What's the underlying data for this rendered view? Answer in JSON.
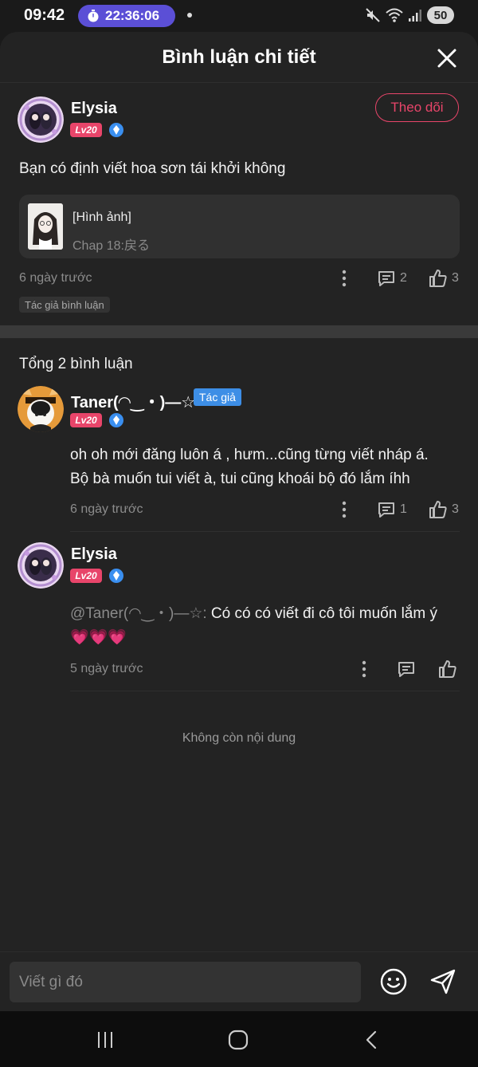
{
  "status_bar": {
    "time": "09:42",
    "timer": "22:36:06",
    "battery": "50"
  },
  "sheet": {
    "title": "Bình luận chi tiết"
  },
  "main_comment": {
    "user": "Elysia",
    "level": "Lv20",
    "follow_label": "Theo dõi",
    "text": "Bạn có định viết hoa sơn tái khởi không",
    "ref_title": "[Hình ảnh]",
    "ref_subtitle": "Chap 18:戻る",
    "time": "6 ngày trước",
    "replies": "2",
    "likes": "3",
    "author_chip": "Tác giả bình luận"
  },
  "replies_section": {
    "total_label": "Tổng 2 bình luận",
    "items": [
      {
        "user": "Taner(◠‿・)—☆",
        "tag": "Tác giả",
        "level": "Lv20",
        "line1": "oh oh mới đăng luôn á , hưm...cũng từng viết nháp á.",
        "line2": "Bộ bà muốn tui viết à, tui cũng khoái bộ đó lắm íhh",
        "time": "6 ngày trước",
        "replies": "1",
        "likes": "3"
      },
      {
        "user": "Elysia",
        "level": "Lv20",
        "mention": "@Taner(◠‿・)—☆:",
        "text": " Có có có viết đi cô tôi muốn lắm ý",
        "hearts": "💗💗💗",
        "time": "5 ngày trước"
      }
    ]
  },
  "no_more": "Không còn nội dung",
  "input": {
    "placeholder": "Viết gì đó"
  },
  "colors": {
    "accent": "#e8456a",
    "author_tag": "#3d8ee6",
    "background": "#232323"
  }
}
